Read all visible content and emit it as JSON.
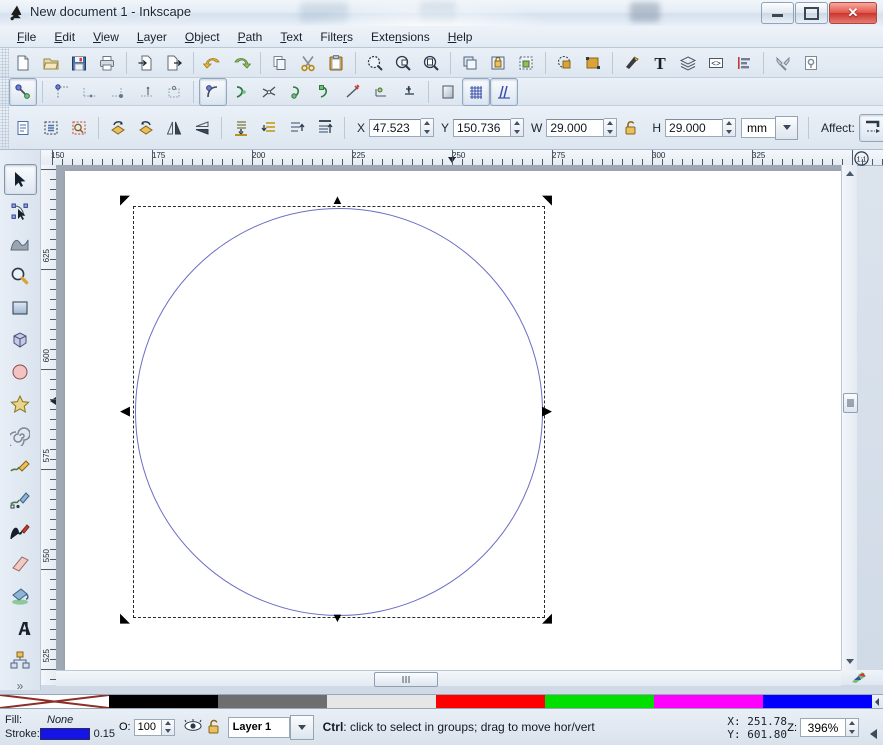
{
  "window": {
    "title": "New document 1 - Inkscape",
    "app_icon": "inkscape-logo-icon",
    "controls": {
      "minimize": "Minimize",
      "maximize": "Maximize",
      "close": "Close"
    }
  },
  "menu": {
    "items": [
      {
        "label": "File",
        "mnemonic": "F"
      },
      {
        "label": "Edit",
        "mnemonic": "E"
      },
      {
        "label": "View",
        "mnemonic": "V"
      },
      {
        "label": "Layer",
        "mnemonic": "L"
      },
      {
        "label": "Object",
        "mnemonic": "O"
      },
      {
        "label": "Path",
        "mnemonic": "P"
      },
      {
        "label": "Text",
        "mnemonic": "T"
      },
      {
        "label": "Filters",
        "mnemonic": "r"
      },
      {
        "label": "Extensions",
        "mnemonic": "n"
      },
      {
        "label": "Help",
        "mnemonic": "H"
      }
    ]
  },
  "command_bar": {
    "buttons": [
      {
        "name": "new-document-icon",
        "title": "New document"
      },
      {
        "name": "open-document-icon",
        "title": "Open"
      },
      {
        "name": "save-document-icon",
        "title": "Save"
      },
      {
        "name": "print-document-icon",
        "title": "Print"
      },
      {
        "name": "import-icon",
        "title": "Import"
      },
      {
        "name": "export-icon",
        "title": "Export"
      },
      {
        "name": "undo-icon",
        "title": "Undo"
      },
      {
        "name": "redo-icon",
        "title": "Redo"
      },
      {
        "name": "copy-icon",
        "title": "Copy"
      },
      {
        "name": "cut-icon",
        "title": "Cut"
      },
      {
        "name": "paste-icon",
        "title": "Paste"
      },
      {
        "name": "zoom-selection-icon",
        "title": "Zoom to selection"
      },
      {
        "name": "zoom-drawing-icon",
        "title": "Zoom to drawing"
      },
      {
        "name": "zoom-page-icon",
        "title": "Zoom to page"
      },
      {
        "name": "duplicate-icon",
        "title": "Duplicate"
      },
      {
        "name": "group-icon",
        "title": "Group"
      },
      {
        "name": "ungroup-icon",
        "title": "Ungroup"
      },
      {
        "name": "fill-stroke-dialog-icon",
        "title": "Fill and Stroke"
      },
      {
        "name": "object-properties-icon",
        "title": "Object properties"
      },
      {
        "name": "xml-editor-icon",
        "title": "XML editor"
      },
      {
        "name": "text-tool-dialog-icon",
        "title": "Text and Font"
      },
      {
        "name": "layers-dialog-icon",
        "title": "Layers"
      },
      {
        "name": "align-dialog-icon",
        "title": "Align and Distribute"
      },
      {
        "name": "preferences-icon",
        "title": "Preferences"
      },
      {
        "name": "document-properties-icon",
        "title": "Document properties"
      }
    ]
  },
  "snap_bar": {
    "buttons": [
      {
        "name": "enable-snapping-icon",
        "title": "Enable snapping",
        "active": true
      },
      {
        "name": "snap-bounding-box-icon",
        "title": "Snap bounding boxes"
      },
      {
        "name": "snap-bbox-edge-icon",
        "title": "Snap to edges"
      },
      {
        "name": "snap-bbox-corner-icon",
        "title": "Snap to corners"
      },
      {
        "name": "snap-bbox-edge-midpoint-icon",
        "title": "Snap edge midpoints"
      },
      {
        "name": "snap-bbox-center-icon",
        "title": "Snap centers"
      },
      {
        "name": "snap-nodes-icon",
        "title": "Snap nodes, paths, handles",
        "active": true
      },
      {
        "name": "snap-path-icon",
        "title": "Snap to paths"
      },
      {
        "name": "snap-path-intersection-icon",
        "title": "Snap path intersections"
      },
      {
        "name": "snap-node-cusp-icon",
        "title": "Snap to cusp nodes"
      },
      {
        "name": "snap-node-smooth-icon",
        "title": "Snap to smooth nodes"
      },
      {
        "name": "snap-line-midpoint-icon",
        "title": "Snap midpoints of lines"
      },
      {
        "name": "snap-object-center-icon",
        "title": "Snap object centers"
      },
      {
        "name": "snap-rotation-center-icon",
        "title": "Snap rotation centers"
      },
      {
        "name": "snap-page-border-icon",
        "title": "Snap to page border"
      },
      {
        "name": "snap-grid-icon",
        "title": "Snap to grids",
        "active": true
      },
      {
        "name": "snap-guide-icon",
        "title": "Snap to guides",
        "active": true
      }
    ]
  },
  "tool_options": {
    "buttons": [
      {
        "name": "select-all-icon",
        "title": "Select all"
      },
      {
        "name": "select-all-in-all-layers-icon",
        "title": "Select all in all layers"
      },
      {
        "name": "deselect-icon",
        "title": "Deselect"
      },
      {
        "name": "rotate-ccw-icon",
        "title": "Rotate 90 counter-clockwise"
      },
      {
        "name": "rotate-cw-icon",
        "title": "Rotate 90 clockwise"
      },
      {
        "name": "flip-horizontal-icon",
        "title": "Flip horizontal"
      },
      {
        "name": "flip-vertical-icon",
        "title": "Flip vertical"
      },
      {
        "name": "lower-to-bottom-icon",
        "title": "Lower to bottom"
      },
      {
        "name": "lower-icon",
        "title": "Lower"
      },
      {
        "name": "raise-icon",
        "title": "Raise"
      },
      {
        "name": "raise-to-top-icon",
        "title": "Raise to top"
      }
    ],
    "fields": [
      {
        "label": "X",
        "name": "x-field",
        "value": "47.523"
      },
      {
        "label": "Y",
        "name": "y-field",
        "value": "150.736"
      },
      {
        "label": "W",
        "name": "width-field",
        "value": "29.000"
      },
      {
        "label": "H",
        "name": "height-field",
        "value": "29.000"
      }
    ],
    "lock_icon": "lock-wh-ratio-icon",
    "units": "mm",
    "affect_label": "Affect:",
    "affect_buttons": [
      {
        "name": "affect-stroke-width-icon",
        "title": "Scale stroke width",
        "active": true
      },
      {
        "name": "affect-rounded-corners-icon",
        "title": "Scale rounded corners",
        "active": true
      }
    ],
    "overflow": "»"
  },
  "toolbox": {
    "tools": [
      {
        "name": "selector-tool",
        "label": "Selector",
        "icon": "arrow-cursor-icon",
        "active": true
      },
      {
        "name": "node-tool",
        "label": "Node editor",
        "icon": "node-edit-icon"
      },
      {
        "name": "tweak-tool",
        "label": "Tweak",
        "icon": "tweak-icon"
      },
      {
        "name": "zoom-tool",
        "label": "Zoom",
        "icon": "magnifier-icon"
      },
      {
        "name": "rectangle-tool",
        "label": "Rectangle",
        "icon": "rectangle-icon"
      },
      {
        "name": "box3d-tool",
        "label": "3D Box",
        "icon": "cube-icon"
      },
      {
        "name": "ellipse-tool",
        "label": "Ellipse",
        "icon": "circle-icon"
      },
      {
        "name": "star-tool",
        "label": "Star",
        "icon": "star-icon"
      },
      {
        "name": "spiral-tool",
        "label": "Spiral",
        "icon": "spiral-icon"
      },
      {
        "name": "pencil-tool",
        "label": "Pencil",
        "icon": "pencil-icon"
      },
      {
        "name": "bezier-tool",
        "label": "Bezier",
        "icon": "pen-icon"
      },
      {
        "name": "calligraphy-tool",
        "label": "Calligraphy",
        "icon": "calligraphy-pen-icon"
      },
      {
        "name": "eraser-tool",
        "label": "Eraser",
        "icon": "eraser-icon"
      },
      {
        "name": "paintbucket-tool",
        "label": "Paint bucket",
        "icon": "paint-bucket-icon"
      },
      {
        "name": "text-tool",
        "label": "Text",
        "icon": "text-a-icon"
      },
      {
        "name": "connector-tool",
        "label": "Connector",
        "icon": "connector-icon"
      }
    ],
    "overflow": "»"
  },
  "rulers": {
    "units": "px",
    "horizontal_labels": [
      "150",
      "175",
      "200",
      "225",
      "250",
      "275",
      "300",
      "325"
    ],
    "vertical_labels": [
      "625",
      "600",
      "575",
      "550",
      "525"
    ],
    "zoom_reset_icon": "zoom-1-to-1-icon"
  },
  "canvas": {
    "selection": {
      "shape": "circle",
      "stroke_color": "#6b6fc4",
      "fill": "none",
      "handles": [
        "nw-scale",
        "n-scale",
        "ne-scale",
        "w-scale",
        "e-scale",
        "sw-scale",
        "s-scale",
        "se-scale"
      ]
    }
  },
  "palette": {
    "swatches": [
      {
        "name": "none",
        "color": "none"
      },
      {
        "name": "black",
        "color": "#000000"
      },
      {
        "name": "gray",
        "color": "#6e6e6e"
      },
      {
        "name": "light-gray",
        "color": "#e6e6e6"
      },
      {
        "name": "red",
        "color": "#ff0000"
      },
      {
        "name": "green",
        "color": "#00e000"
      },
      {
        "name": "magenta",
        "color": "#ff00ff"
      },
      {
        "name": "blue",
        "color": "#0000ff"
      }
    ]
  },
  "status_bar": {
    "fill_label": "Fill:",
    "fill_value": "None",
    "stroke_label": "Stroke:",
    "stroke_color": "#1414e6",
    "stroke_width": "0.15",
    "opacity_label": "O:",
    "opacity_value": "100",
    "visibility_icon": "eye-icon",
    "lock_icon": "layer-unlock-icon",
    "layer_name": "Layer 1",
    "message": "Ctrl: click to select in groups; drag to move hor/vert",
    "message_prefix": "Ctrl",
    "message_rest": ": click to select in groups; drag to move hor/vert",
    "cursor_x_label": "X:",
    "cursor_x": "251.78",
    "cursor_y_label": "Y:",
    "cursor_y": "601.80",
    "zoom_label": "Z:",
    "zoom_value": "396%"
  }
}
